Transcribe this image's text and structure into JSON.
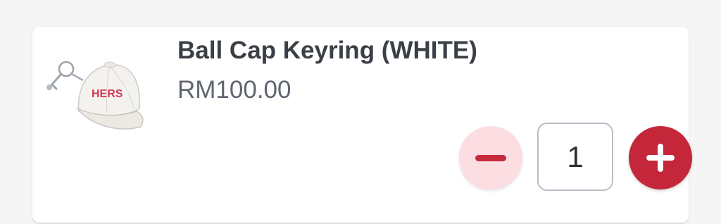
{
  "product": {
    "name": "Ball Cap Keyring (WHITE)",
    "price": "RM100.00",
    "image_icon": "cap-keyring-image",
    "image_logo_text": "HERS"
  },
  "quantity": {
    "value": "1",
    "decrement_icon": "minus-icon",
    "increment_icon": "plus-icon"
  },
  "colors": {
    "accent": "#c4263a",
    "accent_light": "#fcdde2",
    "title_text": "#3b3f46",
    "price_text": "#5f6470"
  }
}
